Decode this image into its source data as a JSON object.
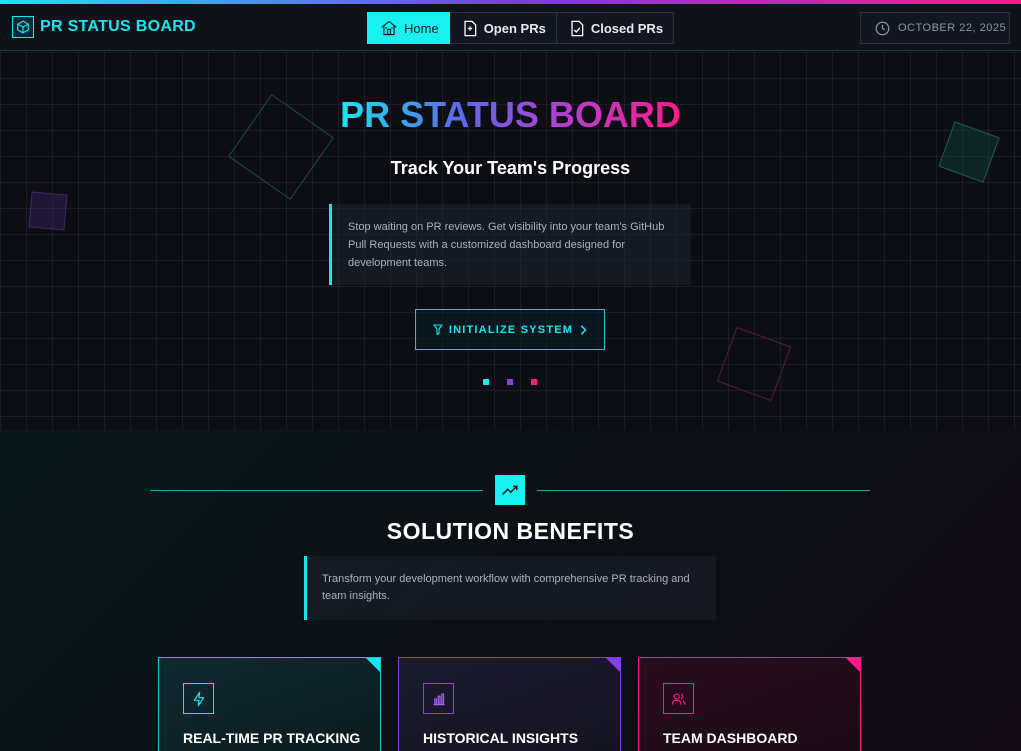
{
  "header": {
    "brand": "PR STATUS BOARD",
    "nav": [
      {
        "label": "Home",
        "active": true
      },
      {
        "label": "Open PRs",
        "active": false
      },
      {
        "label": "Closed PRs",
        "active": false
      }
    ],
    "date": "OCTOBER 22, 2025"
  },
  "hero": {
    "title": "PR STATUS BOARD",
    "subtitle": "Track Your Team's Progress",
    "description": "Stop waiting on PR reviews. Get visibility into your team's GitHub Pull Requests with a customized dashboard designed for development teams.",
    "cta_label": "INITIALIZE SYSTEM",
    "dots": [
      "#19e6f0",
      "#8a3fe4",
      "#ff1a8c"
    ]
  },
  "benefits": {
    "title": "SOLUTION BENEFITS",
    "description": "Transform your development workflow with comprehensive PR tracking and team insights.",
    "cards": [
      {
        "title": "REAL-TIME PR TRACKING",
        "icon": "lightning-icon",
        "color": "#19e6f0"
      },
      {
        "title": "HISTORICAL INSIGHTS",
        "icon": "bar-chart-icon",
        "color": "#8a3fe4"
      },
      {
        "title": "TEAM DASHBOARD",
        "icon": "users-icon",
        "color": "#ff1a8c"
      }
    ]
  },
  "colors": {
    "accent_cyan": "#19e6f0",
    "accent_purple": "#8a3fe4",
    "accent_pink": "#ff1a8c",
    "background": "#0c0d14"
  }
}
